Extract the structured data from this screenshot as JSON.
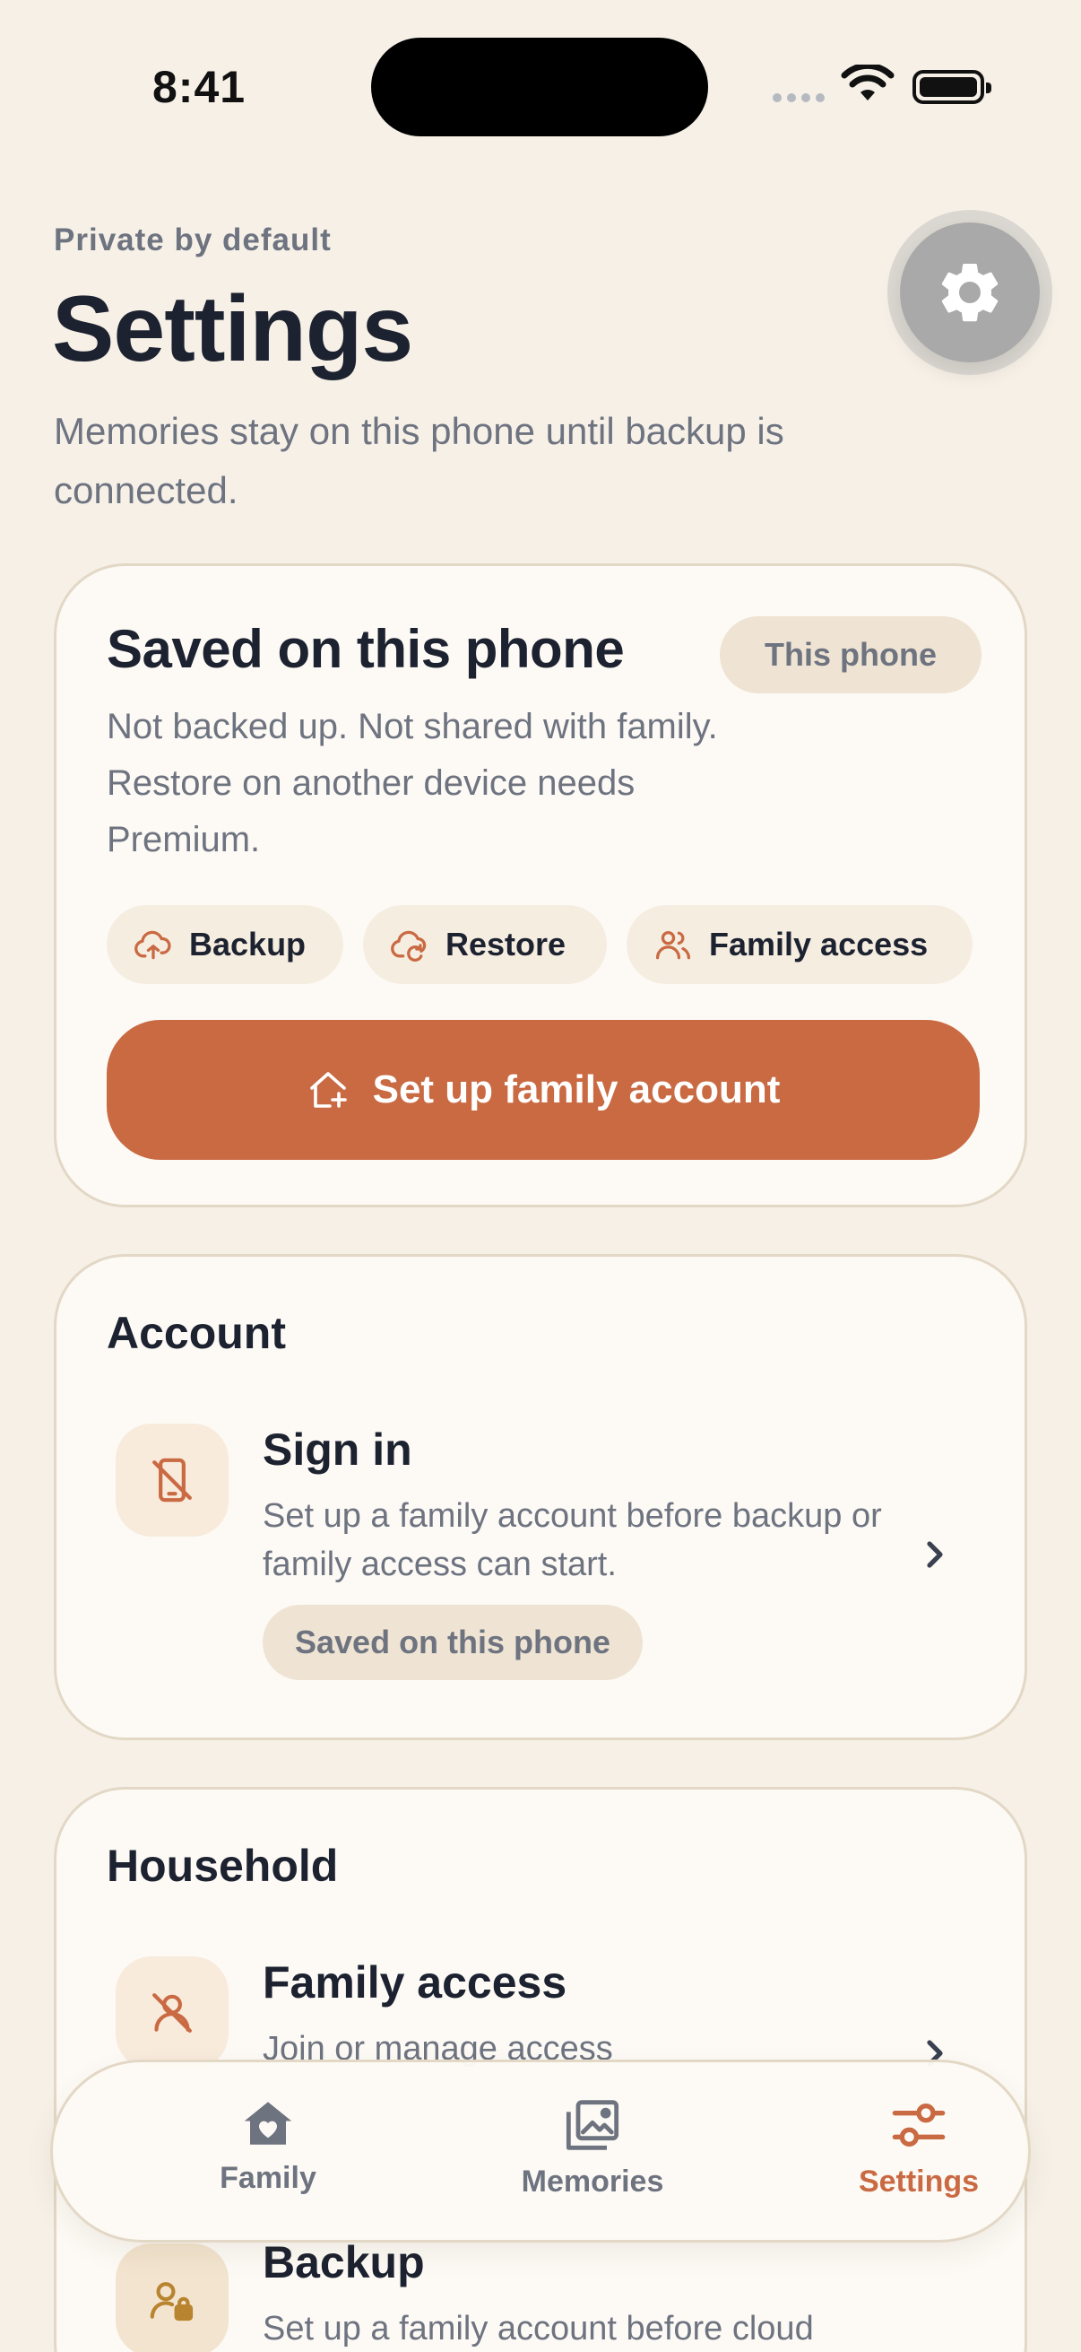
{
  "status_bar": {
    "time": "8:41"
  },
  "header": {
    "eyebrow": "Private by default",
    "title": "Settings",
    "subtitle": "Memories stay on this phone until backup is connected.",
    "settings_icon": "gear-icon"
  },
  "storage_card": {
    "title": "Saved on this phone",
    "badge": "This phone",
    "description": "Not backed up. Not shared with family. Restore on another device needs Premium.",
    "chips": [
      {
        "label": "Backup",
        "icon": "cloud-upload-icon"
      },
      {
        "label": "Restore",
        "icon": "cloud-restore-icon"
      },
      {
        "label": "Family access",
        "icon": "people-icon"
      }
    ],
    "cta_label": "Set up family account",
    "cta_icon": "home-plus-icon"
  },
  "account_section": {
    "title": "Account",
    "rows": [
      {
        "title": "Sign in",
        "description": "Set up a family account before backup or family access can start.",
        "badge": "Saved on this phone",
        "icon": "phone-off-icon"
      }
    ]
  },
  "household_section": {
    "title": "Household",
    "rows": [
      {
        "title": "Family access",
        "description": "Join or manage access",
        "icon": "person-off-icon"
      },
      {
        "title": "Backup",
        "description": "Set up a family account before cloud",
        "icon": "person-lock-icon"
      }
    ]
  },
  "tabbar": {
    "tabs": [
      {
        "label": "Family",
        "icon": "home-heart-icon"
      },
      {
        "label": "Memories",
        "icon": "photos-icon"
      },
      {
        "label": "Settings",
        "icon": "sliders-icon"
      }
    ],
    "active": "Settings"
  },
  "colors": {
    "background": "#f6f0e7",
    "card": "#fdfaf5",
    "accent": "#c96a43",
    "text": "#1d2230",
    "muted": "#6e7380"
  }
}
